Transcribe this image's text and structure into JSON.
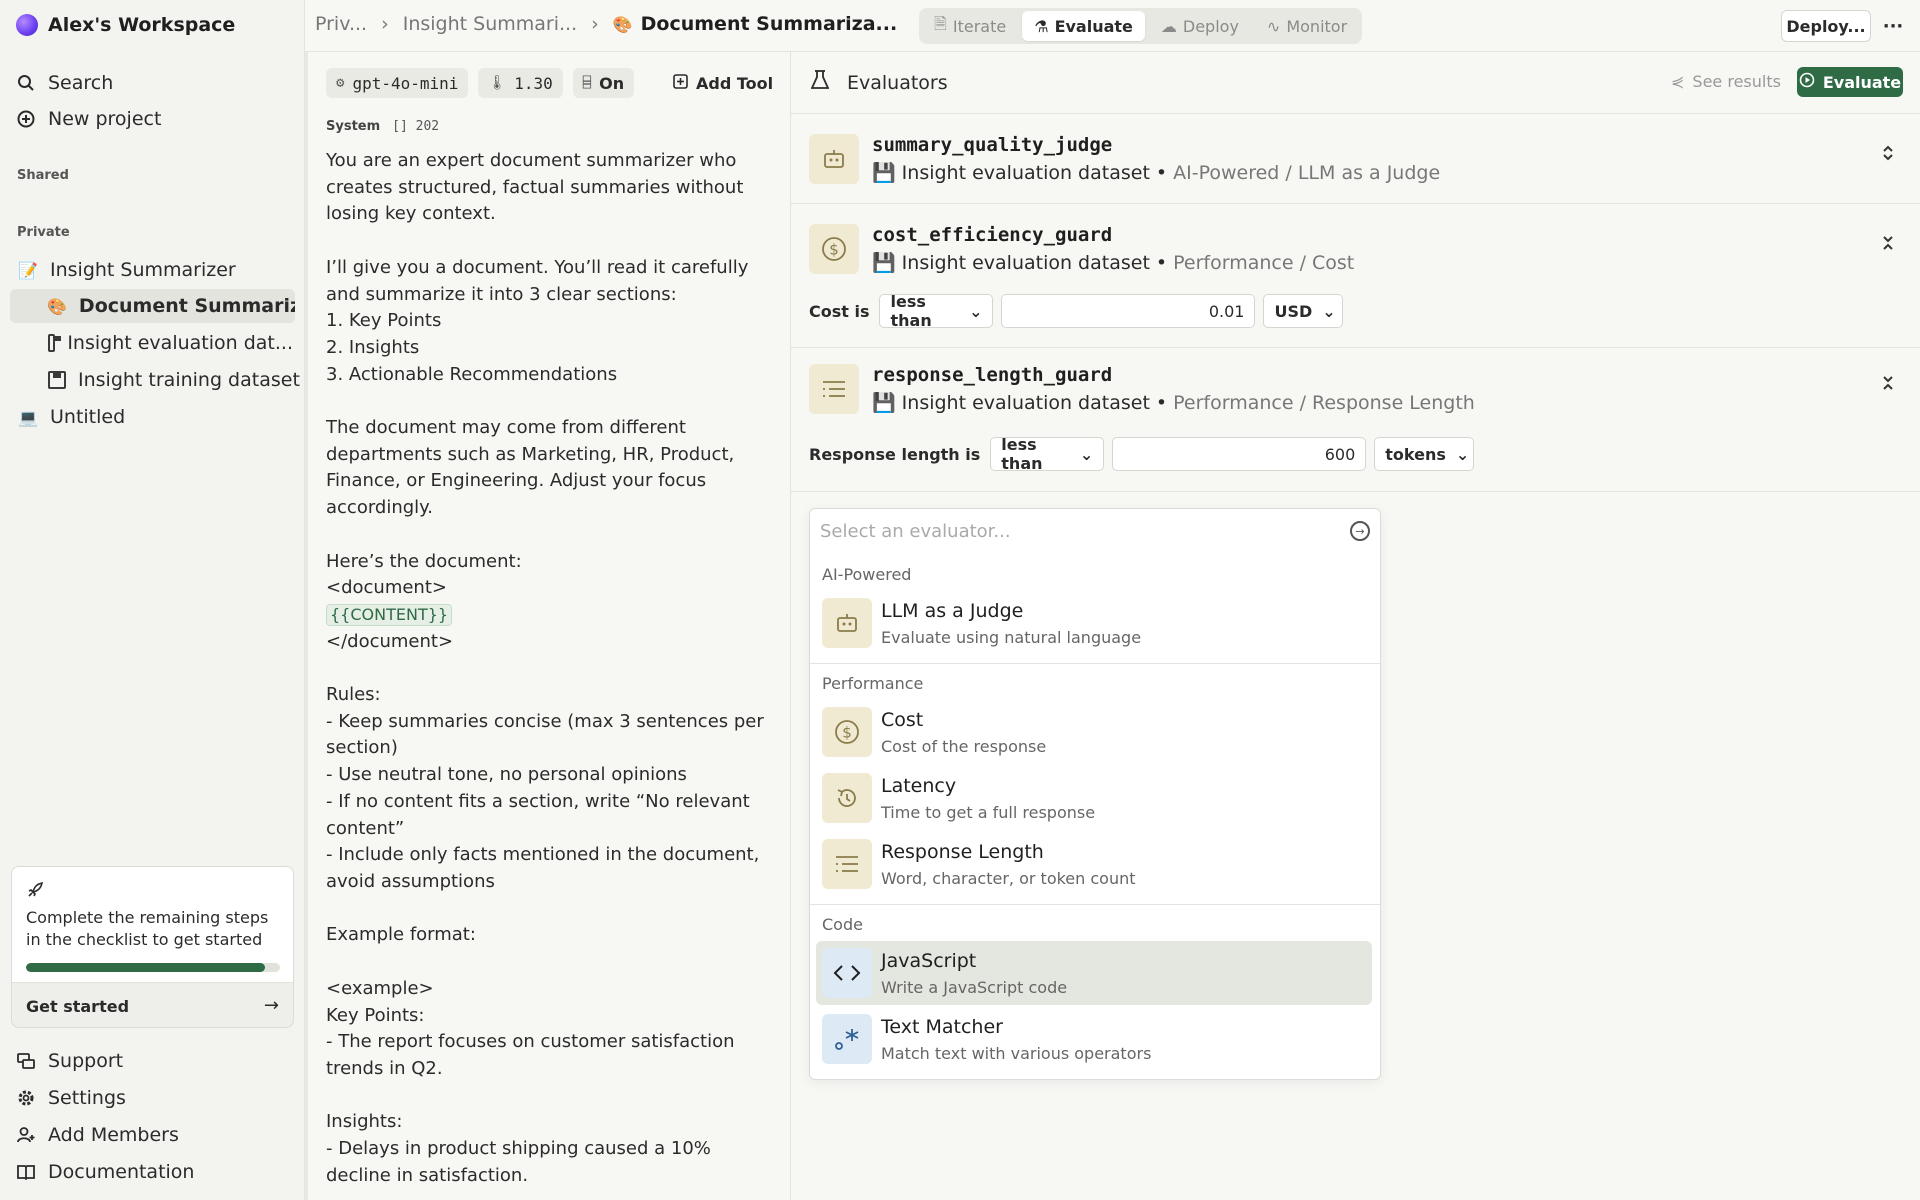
{
  "sidebar": {
    "workspace": "Alex's Workspace",
    "search": "Search",
    "new_project": "New project",
    "shared_label": "Shared",
    "private_label": "Private",
    "tree": [
      {
        "label": "Insight Summarizer",
        "emoji": "📝"
      },
      {
        "label": "Document Summariz...",
        "emoji": "🎨"
      },
      {
        "label": "Insight evaluation dat...",
        "icon": "floppy-disk-icon"
      },
      {
        "label": "Insight training dataset",
        "icon": "floppy-disk-icon"
      },
      {
        "label": "Untitled",
        "emoji": "💻"
      }
    ],
    "checklist": {
      "text": "Complete the remaining steps in the checklist to get started",
      "progress": 0.94,
      "cta": "Get started"
    },
    "footer": [
      "Support",
      "Settings",
      "Add Members",
      "Documentation"
    ]
  },
  "topbar": {
    "breadcrumbs": [
      "Priv...",
      "Insight Summari...",
      "Document Summariza..."
    ],
    "current_emoji": "🎨",
    "modes": [
      "Iterate",
      "Evaluate",
      "Deploy",
      "Monitor"
    ],
    "active_mode": "Evaluate",
    "deploy": "Deploy...",
    "more": "···"
  },
  "prompt": {
    "model": "gpt-4o-mini",
    "temperature": "1.30",
    "json_mode": "On",
    "add_tool": "Add Tool",
    "role": "System",
    "token_count": "202",
    "text_before": "You are an expert document summarizer who creates structured, factual summaries without losing key context.\n\nI’ll give you a document. You’ll read it carefully and summarize it into 3 clear sections:\n1. Key Points\n2. Insights\n3. Actionable Recommendations\n\nThe document may come from different departments such as Marketing, HR, Product, Finance, or Engineering. Adjust your focus accordingly.\n\nHere’s the document:\n<document>\n",
    "variable": "{{CONTENT}}",
    "text_after": "\n</document>\n\nRules:\n- Keep summaries concise (max 3 sentences per section)\n- Use neutral tone, no personal opinions\n- If no content fits a section, write “No relevant content”\n- Include only facts mentioned in the document, avoid assumptions\n\nExample format:\n\n<example>\nKey Points:\n- The report focuses on customer satisfaction trends in Q2.\n\nInsights:\n- Delays in product shipping caused a 10% decline in satisfaction."
  },
  "evaluators": {
    "title": "Evaluators",
    "see_results": "See results",
    "evaluate": "Evaluate",
    "items": [
      {
        "name": "summary_quality_judge",
        "dataset": "Insight evaluation dataset",
        "sep": "•",
        "type": "AI-Powered / LLM as a Judge",
        "icon": "robot-icon",
        "toggle": "⌃⌄"
      },
      {
        "name": "cost_efficiency_guard",
        "dataset": "Insight evaluation dataset",
        "sep": "•",
        "type": "Performance / Cost",
        "icon": "dollar-icon",
        "toggle": "⌄⌃",
        "condition": {
          "label": "Cost is",
          "operator": "less than",
          "value": "0.01",
          "unit": "USD"
        }
      },
      {
        "name": "response_length_guard",
        "dataset": "Insight evaluation dataset",
        "sep": "•",
        "type": "Performance / Response Length",
        "icon": "list-icon",
        "toggle": "⌄⌃",
        "condition": {
          "label": "Response length is",
          "operator": "less than",
          "value": "600",
          "unit": "tokens"
        }
      }
    ]
  },
  "picker": {
    "placeholder": "Select an evaluator...",
    "groups": [
      {
        "label": "AI-Powered",
        "items": [
          {
            "name": "LLM as a Judge",
            "desc": "Evaluate using natural language",
            "icon": "robot-icon"
          }
        ]
      },
      {
        "label": "Performance",
        "items": [
          {
            "name": "Cost",
            "desc": "Cost of the response",
            "icon": "dollar-icon"
          },
          {
            "name": "Latency",
            "desc": "Time to get a full response",
            "icon": "timer-icon"
          },
          {
            "name": "Response Length",
            "desc": "Word, character, or token count",
            "icon": "list-icon"
          }
        ]
      },
      {
        "label": "Code",
        "items": [
          {
            "name": "JavaScript",
            "desc": "Write a JavaScript code",
            "icon": "code-icon",
            "highlighted": true
          },
          {
            "name": "Text Matcher",
            "desc": "Match text with various operators",
            "icon": "regex-icon"
          }
        ]
      }
    ]
  },
  "colors": {
    "accent": "#2f6b45",
    "evaluator_icon_bg": "#f1ead2",
    "code_icon_bg": "#dde9f5"
  }
}
